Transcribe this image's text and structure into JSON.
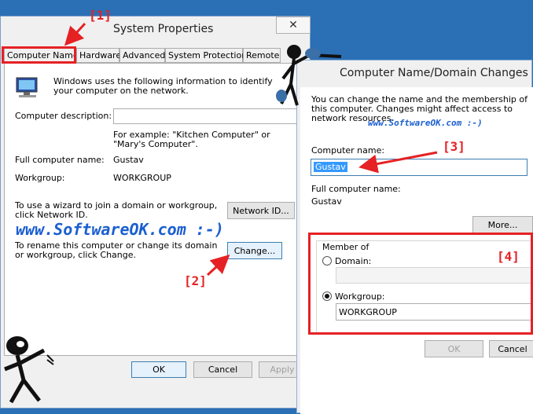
{
  "sysprops": {
    "title": "System Properties",
    "close": "✕",
    "tabs": [
      "Computer Name",
      "Hardware",
      "Advanced",
      "System Protection",
      "Remote"
    ],
    "intro": "Windows uses the following information to identify your computer on the network.",
    "desc_label": "Computer description:",
    "desc_value": "",
    "example": "For example: \"Kitchen Computer\" or \"Mary's Computer\".",
    "fullname_label": "Full computer name:",
    "fullname_value": "Gustav",
    "workgroup_label": "Workgroup:",
    "workgroup_value": "WORKGROUP",
    "wizard_text": "To use a wizard to join a domain or workgroup, click Network ID.",
    "network_id_btn": "Network ID...",
    "rename_text": "To rename this computer or change its domain or workgroup, click Change.",
    "change_btn": "Change...",
    "ok": "OK",
    "cancel": "Cancel",
    "apply": "Apply"
  },
  "domain": {
    "title": "Computer Name/Domain Changes",
    "intro": "You can change the name and the membership of this computer. Changes might affect access to network resources.",
    "name_label": "Computer name:",
    "name_value": "Gustav",
    "full_label": "Full computer name:",
    "full_value": "Gustav",
    "more_btn": "More...",
    "member_of": "Member of",
    "domain_label": "Domain:",
    "domain_value": "",
    "workgroup_label": "Workgroup:",
    "workgroup_value": "WORKGROUP",
    "ok": "OK",
    "cancel": "Cancel"
  },
  "annotations": {
    "l1": "[1]",
    "l2": "[2]",
    "l3": "[3]",
    "l4": "[4]",
    "watermark_big": "www.SoftwareOK.com :-)",
    "watermark_small": "www.SoftwareOK.com :-)"
  },
  "colors": {
    "annotation": "#e52124",
    "watermark": "#1a5fd0",
    "desktop": "#2b6fb5"
  }
}
